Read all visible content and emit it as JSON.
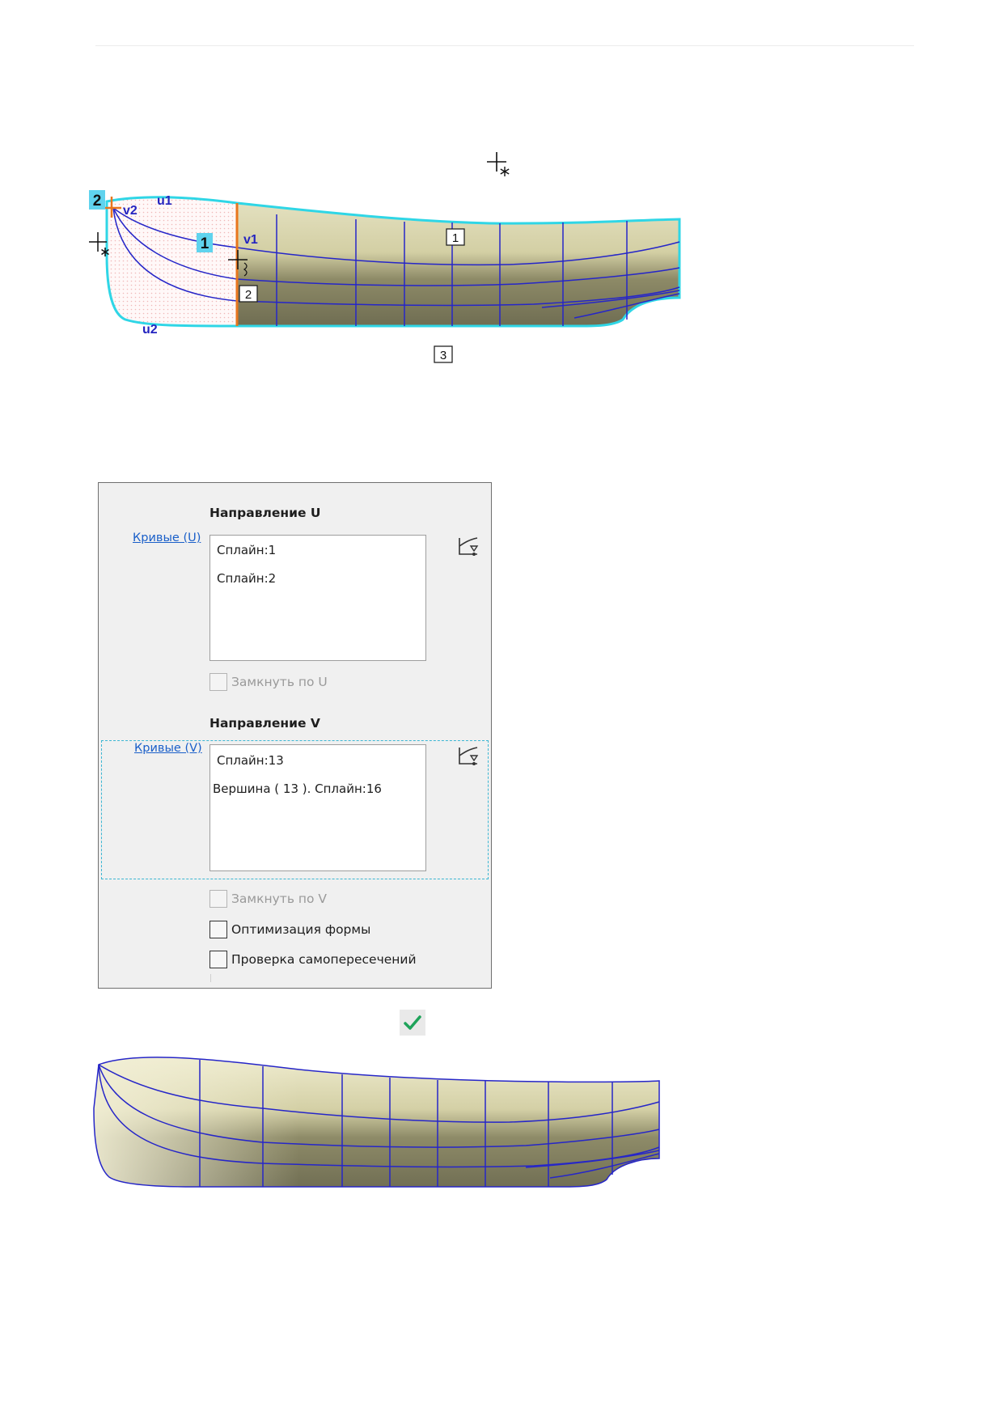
{
  "figure1": {
    "labels": {
      "badge_1": "1",
      "badge_2": "2",
      "u1": "u1",
      "u2": "u2",
      "v1": "v1",
      "v2": "v2",
      "box_1": "1",
      "box_2": "2",
      "box_3": "3"
    }
  },
  "panel": {
    "u_section": {
      "title": "Направление U",
      "link": "Кривые (U)",
      "items": [
        "Сплайн:1",
        "Сплайн:2"
      ],
      "close_label": "Замкнуть по U"
    },
    "v_section": {
      "title": "Направление V",
      "link": "Кривые (V)",
      "items": [
        "Сплайн:13",
        "Вершина ( 13 ). Сплайн:16"
      ],
      "close_label": "Замкнуть по V"
    },
    "options": {
      "shape_optimization": "Оптимизация формы",
      "self_intersection_check": "Проверка самопересечений"
    }
  },
  "colors": {
    "cyan_outline": "#2fd6e6",
    "grid_blue": "#2626c8",
    "orange_curve": "#e8761e",
    "label_blue": "#2424c0",
    "badge_fill": "#5fd3ee",
    "check_green": "#1fa35a"
  },
  "icons": {
    "cursor": "crosshair-asterisk-icon",
    "pick": "select-curve-icon",
    "ok": "checkmark-icon"
  }
}
